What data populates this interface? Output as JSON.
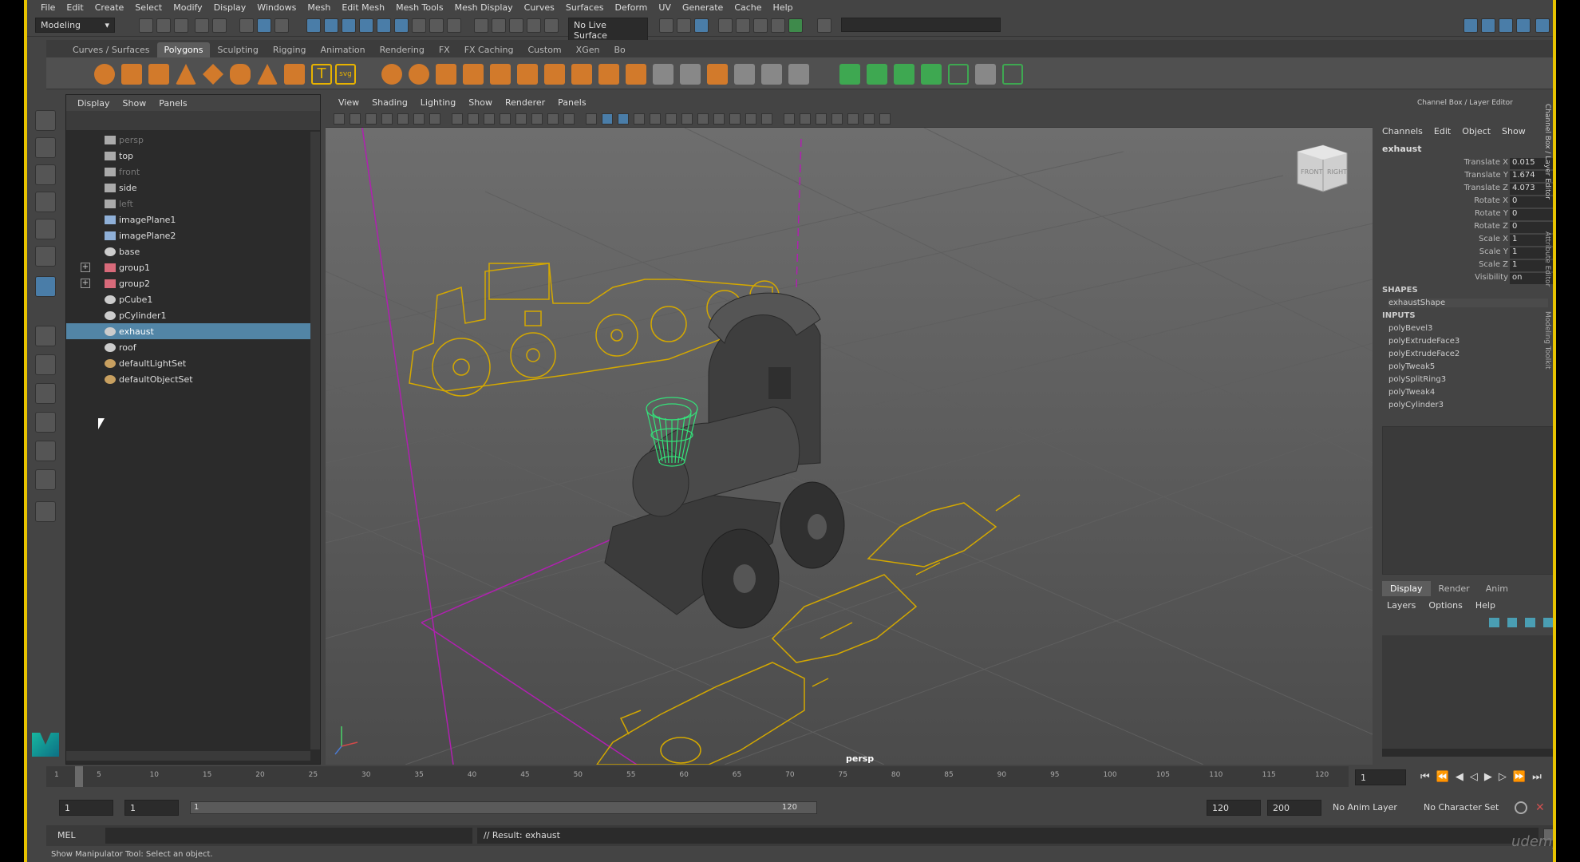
{
  "menubar": [
    "File",
    "Edit",
    "Create",
    "Select",
    "Modify",
    "Display",
    "Windows",
    "Mesh",
    "Edit Mesh",
    "Mesh Tools",
    "Mesh Display",
    "Curves",
    "Surfaces",
    "Deform",
    "UV",
    "Generate",
    "Cache",
    "Help"
  ],
  "statusline": {
    "mode": "Modeling",
    "live_surface": "No Live Surface"
  },
  "shelf_tabs": [
    "Curves / Surfaces",
    "Polygons",
    "Sculpting",
    "Rigging",
    "Animation",
    "Rendering",
    "FX",
    "FX Caching",
    "Custom",
    "XGen",
    "Bo"
  ],
  "shelf_active": "Polygons",
  "outliner": {
    "menu": [
      "Display",
      "Show",
      "Panels"
    ],
    "items": [
      {
        "label": "persp",
        "dim": true,
        "icon": "camera-icon"
      },
      {
        "label": "top",
        "dim": false,
        "icon": "camera-icon"
      },
      {
        "label": "front",
        "dim": true,
        "icon": "camera-icon"
      },
      {
        "label": "side",
        "dim": false,
        "icon": "camera-icon"
      },
      {
        "label": "left",
        "dim": true,
        "icon": "camera-icon"
      },
      {
        "label": "imagePlane1",
        "dim": false,
        "icon": "image-plane-icon"
      },
      {
        "label": "imagePlane2",
        "dim": false,
        "icon": "image-plane-icon"
      },
      {
        "label": "base",
        "dim": false,
        "icon": "mesh-icon"
      },
      {
        "label": "group1",
        "dim": false,
        "icon": "group-icon",
        "expandable": true
      },
      {
        "label": "group2",
        "dim": false,
        "icon": "group-icon",
        "expandable": true
      },
      {
        "label": "pCube1",
        "dim": false,
        "icon": "mesh-icon"
      },
      {
        "label": "pCylinder1",
        "dim": false,
        "icon": "mesh-icon"
      },
      {
        "label": "exhaust",
        "dim": false,
        "icon": "mesh-icon",
        "selected": true
      },
      {
        "label": "roof",
        "dim": false,
        "icon": "mesh-icon"
      },
      {
        "label": "defaultLightSet",
        "dim": false,
        "icon": "set-icon"
      },
      {
        "label": "defaultObjectSet",
        "dim": false,
        "icon": "set-icon"
      }
    ]
  },
  "viewport": {
    "menu": [
      "View",
      "Shading",
      "Lighting",
      "Show",
      "Renderer",
      "Panels"
    ],
    "camera_label": "persp",
    "cube_front": "FRONT",
    "cube_right": "RIGHT"
  },
  "channel_box": {
    "title": "Channel Box / Layer Editor",
    "menu": [
      "Channels",
      "Edit",
      "Object",
      "Show"
    ],
    "object": "exhaust",
    "attrs": [
      {
        "label": "Translate X",
        "value": "0.015"
      },
      {
        "label": "Translate Y",
        "value": "1.674"
      },
      {
        "label": "Translate Z",
        "value": "4.073"
      },
      {
        "label": "Rotate X",
        "value": "0"
      },
      {
        "label": "Rotate Y",
        "value": "0"
      },
      {
        "label": "Rotate Z",
        "value": "0"
      },
      {
        "label": "Scale X",
        "value": "1"
      },
      {
        "label": "Scale Y",
        "value": "1"
      },
      {
        "label": "Scale Z",
        "value": "1"
      },
      {
        "label": "Visibility",
        "value": "on"
      }
    ],
    "shapes_header": "SHAPES",
    "shapes": [
      "exhaustShape"
    ],
    "inputs_header": "INPUTS",
    "inputs": [
      "polyBevel3",
      "polyExtrudeFace3",
      "polyExtrudeFace2",
      "polyTweak5",
      "polySplitRing3",
      "polyTweak4",
      "polyCylinder3"
    ],
    "layer_tabs": [
      "Display",
      "Render",
      "Anim"
    ],
    "layer_menu": [
      "Layers",
      "Options",
      "Help"
    ]
  },
  "side_tabs": [
    "Channel Box / Layer Editor",
    "Attribute Editor",
    "Modeling Toolkit"
  ],
  "timeline": {
    "ticks": [
      "1",
      "5",
      "10",
      "15",
      "20",
      "25",
      "30",
      "35",
      "40",
      "45",
      "50",
      "55",
      "60",
      "65",
      "70",
      "75",
      "80",
      "85",
      "90",
      "95",
      "100",
      "105",
      "110",
      "115",
      "120"
    ],
    "current_frame": "1"
  },
  "range": {
    "start": "1",
    "playback_start": "1",
    "slider_start": "1",
    "slider_end": "120",
    "playback_end": "120",
    "end": "200",
    "anim_layer": "No Anim Layer",
    "char_set": "No Character Set"
  },
  "cmdline": {
    "lang": "MEL",
    "result": "// Result: exhaust"
  },
  "helpline": "Show Manipulator Tool: Select an object.",
  "watermark": "udemy"
}
